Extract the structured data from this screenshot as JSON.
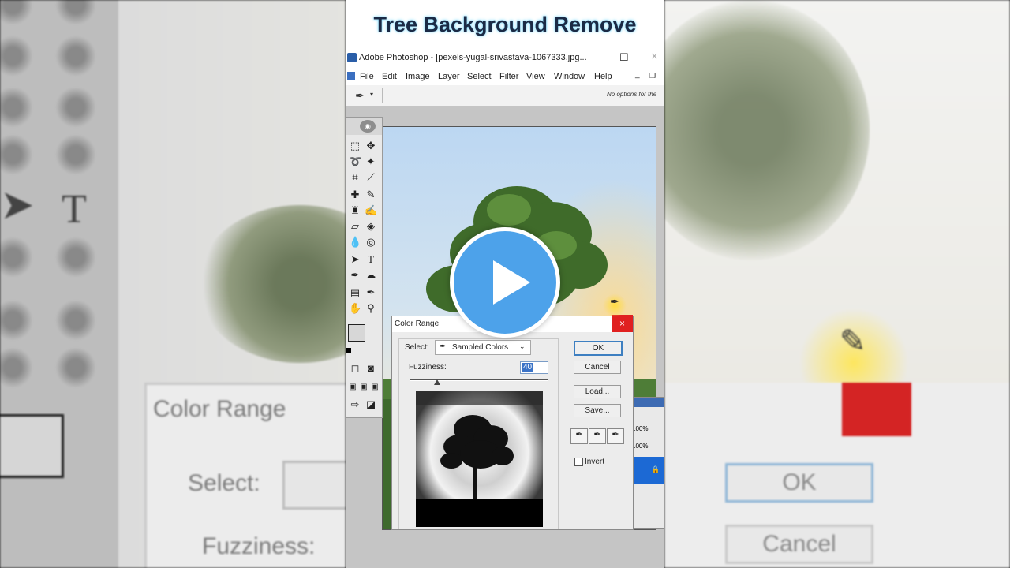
{
  "video_title": "Tree Background Remove",
  "photoshop": {
    "window_title": "Adobe Photoshop - [pexels-yugal-srivastava-1067333.jpg...",
    "window_controls": {
      "minimize": "–",
      "maximize": "☐",
      "close": "×"
    },
    "menu": [
      "File",
      "Edit",
      "Image",
      "Layer",
      "Select",
      "Filter",
      "View",
      "Window",
      "Help"
    ],
    "options_bar_text": "No options for the"
  },
  "color_range_dialog": {
    "title": "Color Range",
    "select_label": "Select:",
    "select_value": "Sampled Colors",
    "fuzziness_label": "Fuzziness:",
    "fuzziness_value": "40",
    "ok_label": "OK",
    "cancel_label": "Cancel",
    "load_label": "Load...",
    "save_label": "Save...",
    "invert_label": "Invert",
    "invert_checked": false
  },
  "side_panel": {
    "zoom_1": "100%",
    "zoom_2": "100%"
  },
  "backdrop": {
    "dialog_title": "Color Range",
    "select_label": "Select:",
    "fuzziness_label": "Fuzziness:",
    "ok_label": "OK",
    "cancel_label": "Cancel"
  },
  "colors": {
    "accent": "#3d7fc1",
    "play_button": "#4da2ea",
    "close_red": "#e02020"
  },
  "icons": [
    "eyedropper-icon",
    "play-icon",
    "marquee-icon",
    "move-icon",
    "lasso-icon",
    "magic-wand-icon",
    "crop-icon",
    "brush-icon",
    "stamp-icon",
    "eraser-icon",
    "bucket-icon",
    "blur-icon",
    "pen-icon",
    "type-icon",
    "hand-icon",
    "zoom-icon"
  ]
}
